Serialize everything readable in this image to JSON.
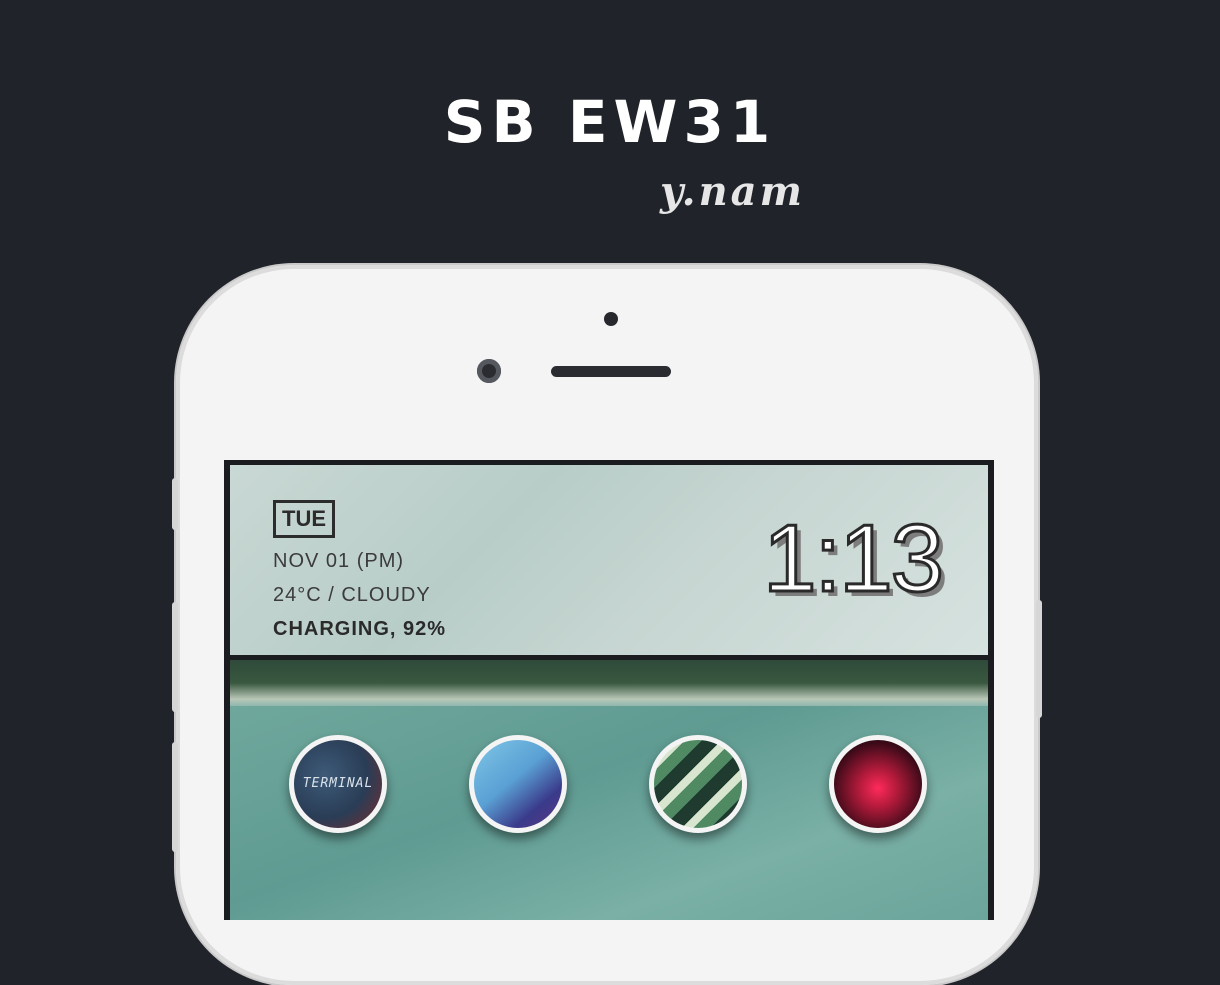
{
  "promo": {
    "title": "SB EW31",
    "author": "y.nam"
  },
  "widget": {
    "day": "TUE",
    "date": "NOV 01 (PM)",
    "weather": "24°C / CLOUDY",
    "battery": "CHARGING, 92%",
    "time": "1:13"
  },
  "dock": {
    "icons": [
      {
        "label": "TERMINAL"
      }
    ]
  }
}
